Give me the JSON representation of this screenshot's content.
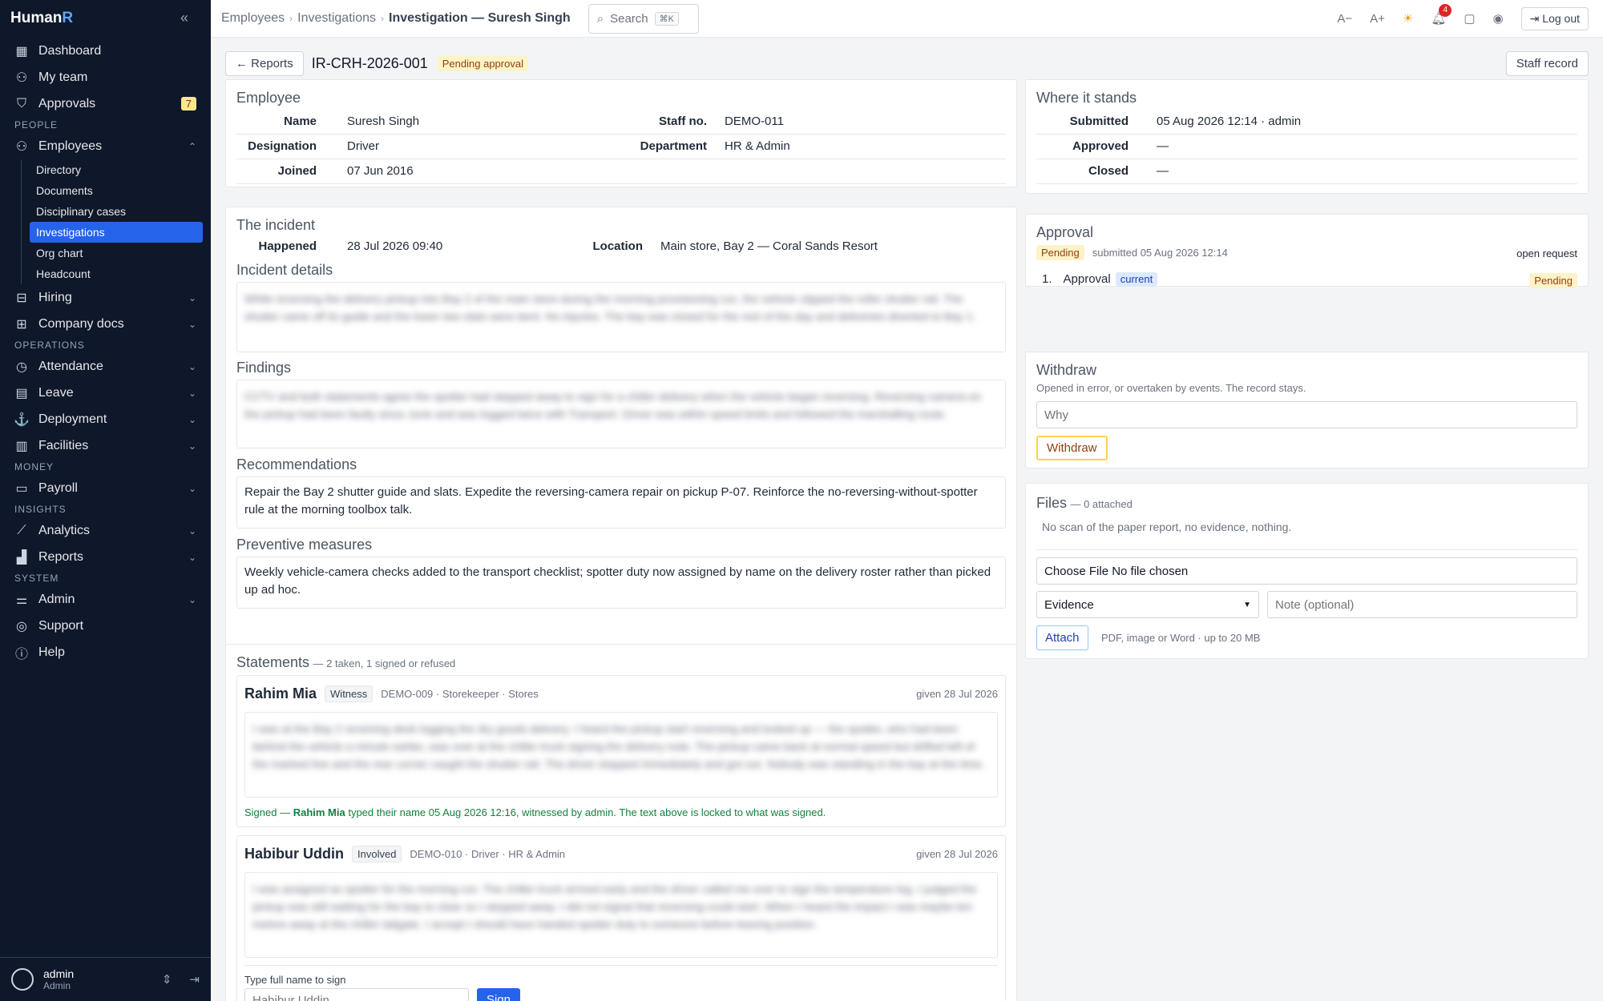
{
  "app": {
    "brand_a": "Human",
    "brand_b": "R"
  },
  "sidebar": {
    "dashboard": "Dashboard",
    "my_team": "My team",
    "approvals": "Approvals",
    "approvals_count": "7",
    "sec_people": "PEOPLE",
    "employees": "Employees",
    "emp_sub": [
      "Directory",
      "Documents",
      "Disciplinary cases",
      "Investigations",
      "Org chart",
      "Headcount"
    ],
    "hiring": "Hiring",
    "company_docs": "Company docs",
    "sec_operations": "OPERATIONS",
    "attendance": "Attendance",
    "leave": "Leave",
    "deployment": "Deployment",
    "facilities": "Facilities",
    "sec_money": "MONEY",
    "payroll": "Payroll",
    "sec_insights": "INSIGHTS",
    "analytics": "Analytics",
    "reports": "Reports",
    "sec_system": "SYSTEM",
    "admin": "Admin",
    "support": "Support",
    "help": "Help",
    "user_name": "admin",
    "user_role": "Admin"
  },
  "topbar": {
    "crumb1": "Employees",
    "crumb2": "Investigations",
    "crumb3": "Investigation — Suresh Singh",
    "search": "Search",
    "kbd": "⌘K",
    "font_dec": "A−",
    "font_inc": "A+",
    "notif_count": "4",
    "logout": "Log out"
  },
  "header": {
    "back": "← Reports",
    "id": "IR-CRH-2026-001",
    "status": "Pending approval",
    "staff_record": "Staff record"
  },
  "employee": {
    "title": "Employee",
    "name_k": "Name",
    "name_v": "Suresh Singh",
    "staff_k": "Staff no.",
    "staff_v": "DEMO-011",
    "desig_k": "Designation",
    "desig_v": "Driver",
    "dept_k": "Department",
    "dept_v": "HR & Admin",
    "joined_k": "Joined",
    "joined_v": "07 Jun 2016"
  },
  "incident": {
    "title": "The incident",
    "happened_k": "Happened",
    "happened_v": "28 Jul 2026 09:40",
    "location_k": "Location",
    "location_v": "Main store, Bay 2 — Coral Sands Resort",
    "details_title": "Incident details",
    "details_text": "While reversing the delivery pickup into Bay 2 of the main store during the morning provisioning run, the vehicle clipped the roller shutter rail. The shutter came off its guide and the lower two slats were bent. No injuries. The bay was closed for the rest of the day and deliveries diverted to Bay 1.",
    "findings_title": "Findings",
    "findings_text": "CCTV and both statements agree the spotter had stepped away to sign for a chiller delivery when the vehicle began reversing. Reversing camera on the pickup had been faulty since June and was logged twice with Transport. Driver was within speed limits and followed the marshalling route.",
    "rec_title": "Recommendations",
    "rec_text": "Repair the Bay 2 shutter guide and slats. Expedite the reversing-camera repair on pickup P-07. Reinforce the no-reversing-without-spotter rule at the morning toolbox talk.",
    "prev_title": "Preventive measures",
    "prev_text": "Weekly vehicle-camera checks added to the transport checklist; spotter duty now assigned by name on the delivery roster rather than picked up ad hoc."
  },
  "statements": {
    "title": "Statements",
    "meta": "— 2 taken, 1 signed or refused",
    "s1": {
      "name": "Rahim Mia",
      "role": "Witness",
      "info": "DEMO-009 · Storekeeper · Stores",
      "given": "given 28 Jul 2026",
      "text": "I was at the Bay 2 receiving desk logging the dry goods delivery. I heard the pickup start reversing and looked up — the spotter, who had been behind the vehicle a minute earlier, was over at the chiller truck signing the delivery note. The pickup came back at normal speed but drifted left of the marked line and the rear corner caught the shutter rail. The driver stopped immediately and got out. Nobody was standing in the bay at the time.",
      "signed_a": "Signed — ",
      "signed_name": "Rahim Mia",
      "signed_b": " typed their name 05 Aug 2026 12:16, witnessed by admin. The text above is locked to what was signed."
    },
    "s2": {
      "name": "Habibur Uddin",
      "role": "Involved",
      "info": "DEMO-010 · Driver · HR & Admin",
      "given": "given 28 Jul 2026",
      "text": "I was assigned as spotter for the morning run. The chiller truck arrived early and the driver called me over to sign the temperature log. I judged the pickup was still waiting for the bay to clear so I stepped away. I did not signal that reversing could start. When I heard the impact I was maybe ten metres away at the chiller tailgate. I accept I should have handed spotter duty to someone before leaving position.",
      "sign_label": "Type full name to sign",
      "sign_placeholder": "Habibur Uddin",
      "sign_btn": "Sign"
    }
  },
  "standing": {
    "title": "Where it stands",
    "submitted_k": "Submitted",
    "submitted_v": "05 Aug 2026 12:14 · admin",
    "approved_k": "Approved",
    "approved_v": "—",
    "closed_k": "Closed",
    "closed_v": "—"
  },
  "approval": {
    "title": "Approval",
    "status": "Pending",
    "submitted": "submitted 05 Aug 2026 12:14",
    "open": "open request",
    "step_no": "1.",
    "step_name": "Approval",
    "step_tag": "current",
    "step_status": "Pending"
  },
  "withdraw": {
    "title": "Withdraw",
    "desc": "Opened in error, or overtaken by events. The record stays.",
    "placeholder": "Why",
    "btn": "Withdraw"
  },
  "files": {
    "title": "Files",
    "count": "— 0 attached",
    "empty": "No scan of the paper report, no evidence, nothing.",
    "choose": "Choose File",
    "no_file": "No file chosen",
    "type": "Evidence",
    "note_placeholder": "Note (optional)",
    "attach": "Attach",
    "hint": "PDF, image or Word · up to 20 MB"
  }
}
